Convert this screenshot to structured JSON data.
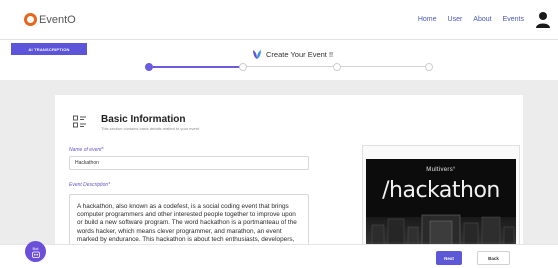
{
  "app": {
    "name": "EventO",
    "colors": {
      "accent": "#5c55d9",
      "brand_orange": "#e8651c"
    }
  },
  "nav": {
    "links": [
      {
        "label": "Home"
      },
      {
        "label": "User"
      },
      {
        "label": "About"
      },
      {
        "label": "Events"
      }
    ],
    "user_icon": "user-icon"
  },
  "toolbar": {
    "ai_button_label": "AI TRANSCRIPTION",
    "page_title": "Create Your Event !!"
  },
  "stepper": {
    "total_steps": 4,
    "current_step": 1
  },
  "section": {
    "title": "Basic Information",
    "subtitle": "This section contains basic details realted to your event"
  },
  "form": {
    "name_label": "Name of event*",
    "name_value": "Hackathon",
    "desc_label": "Event Description*",
    "desc_value": "A hackathon, also known as a codefest, is a social coding event that brings computer programmers and other interested people together to improve upon or build a new software program. The word hackathon is a portmanteau of the words hacker, which means clever programmer, and marathon, an event marked by endurance. This hackathon is about tech enthusiasts, developers, and coders."
  },
  "event_image": {
    "brand": "Multivers°",
    "title": "/hackathon"
  },
  "footer": {
    "next_label": "Next",
    "back_label": "Back"
  },
  "bot": {
    "label": "Bot"
  }
}
